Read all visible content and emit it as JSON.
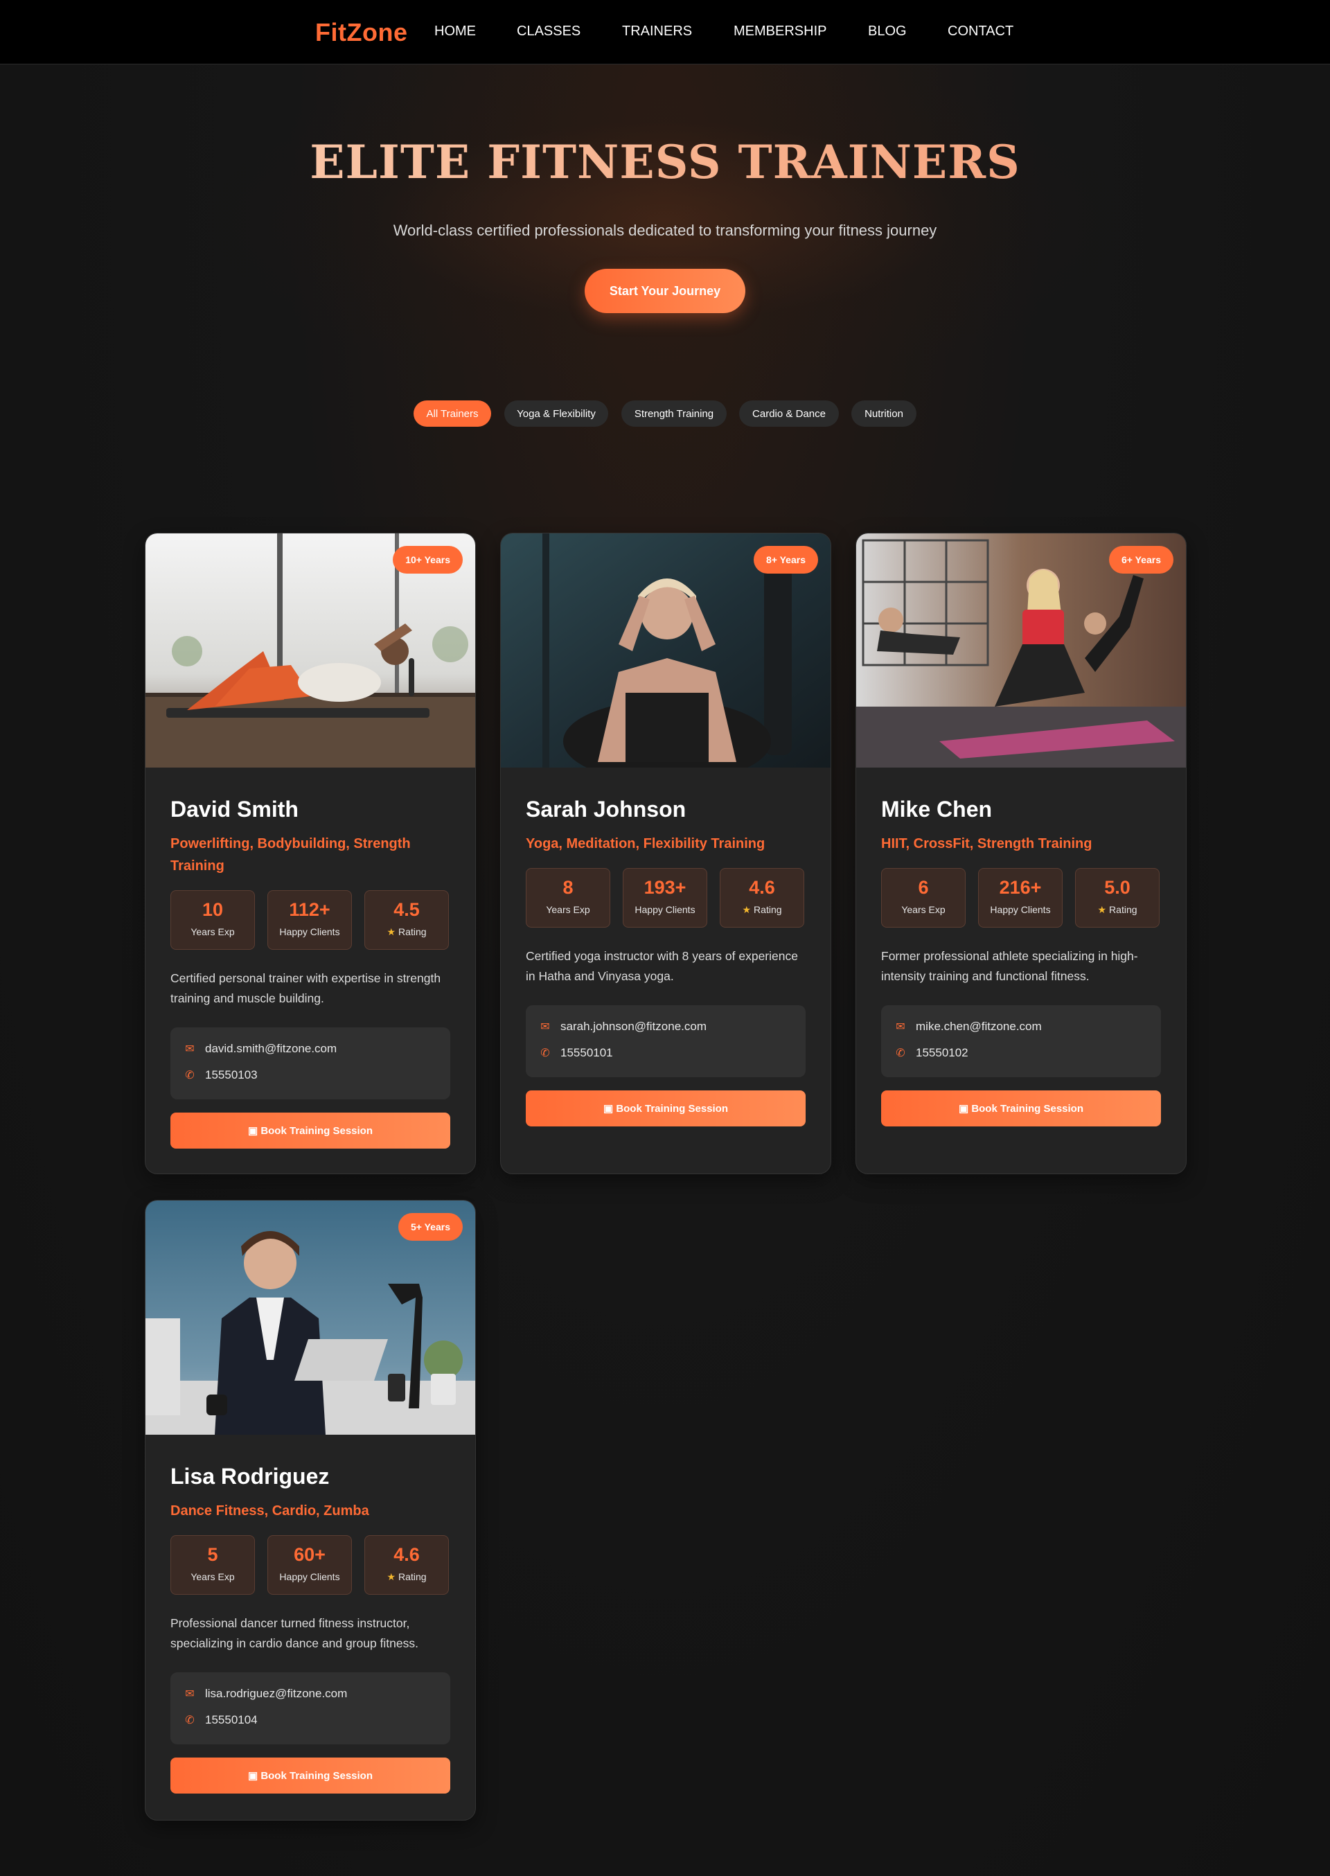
{
  "brand": "FitZone",
  "nav": [
    "HOME",
    "CLASSES",
    "TRAINERS",
    "MEMBERSHIP",
    "BLOG",
    "CONTACT"
  ],
  "hero": {
    "title": "ELITE FITNESS TRAINERS",
    "subtitle": "World-class certified professionals dedicated to transforming your fitness journey",
    "cta": "Start Your Journey"
  },
  "filters": [
    "All Trainers",
    "Yoga & Flexibility",
    "Strength Training",
    "Cardio & Dance",
    "Nutrition"
  ],
  "active_filter": "All Trainers",
  "labels": {
    "years": "Years Exp",
    "clients": "Happy Clients",
    "rating": "Rating",
    "book": "Book Training Session"
  },
  "colors": {
    "accent": "#ff6b35",
    "star": "#f5b82e",
    "background": "#141414",
    "card": "#232323"
  },
  "icons": {
    "email": "envelope-icon",
    "phone": "phone-icon",
    "book": "calendar-icon",
    "rating": "star-icon"
  },
  "trainers": [
    {
      "badge": "10+ Years",
      "name": "David Smith",
      "specialties": "Powerlifting, Bodybuilding, Strength Training",
      "years": "10",
      "clients": "112+",
      "rating": "4.5",
      "bio": "Certified personal trainer with expertise in strength training and muscle building.",
      "email": "david.smith@fitzone.com",
      "phone": "15550103"
    },
    {
      "badge": "8+ Years",
      "name": "Sarah Johnson",
      "specialties": "Yoga, Meditation, Flexibility Training",
      "years": "8",
      "clients": "193+",
      "rating": "4.6",
      "bio": "Certified yoga instructor with 8 years of experience in Hatha and Vinyasa yoga.",
      "email": "sarah.johnson@fitzone.com",
      "phone": "15550101"
    },
    {
      "badge": "6+ Years",
      "name": "Mike Chen",
      "specialties": "HIIT, CrossFit, Strength Training",
      "years": "6",
      "clients": "216+",
      "rating": "5.0",
      "bio": "Former professional athlete specializing in high-intensity training and functional fitness.",
      "email": "mike.chen@fitzone.com",
      "phone": "15550102"
    },
    {
      "badge": "5+ Years",
      "name": "Lisa Rodriguez",
      "specialties": "Dance Fitness, Cardio, Zumba",
      "years": "5",
      "clients": "60+",
      "rating": "4.6",
      "bio": "Professional dancer turned fitness instructor, specializing in cardio dance and group fitness.",
      "email": "lisa.rodriguez@fitzone.com",
      "phone": "15550104"
    }
  ]
}
